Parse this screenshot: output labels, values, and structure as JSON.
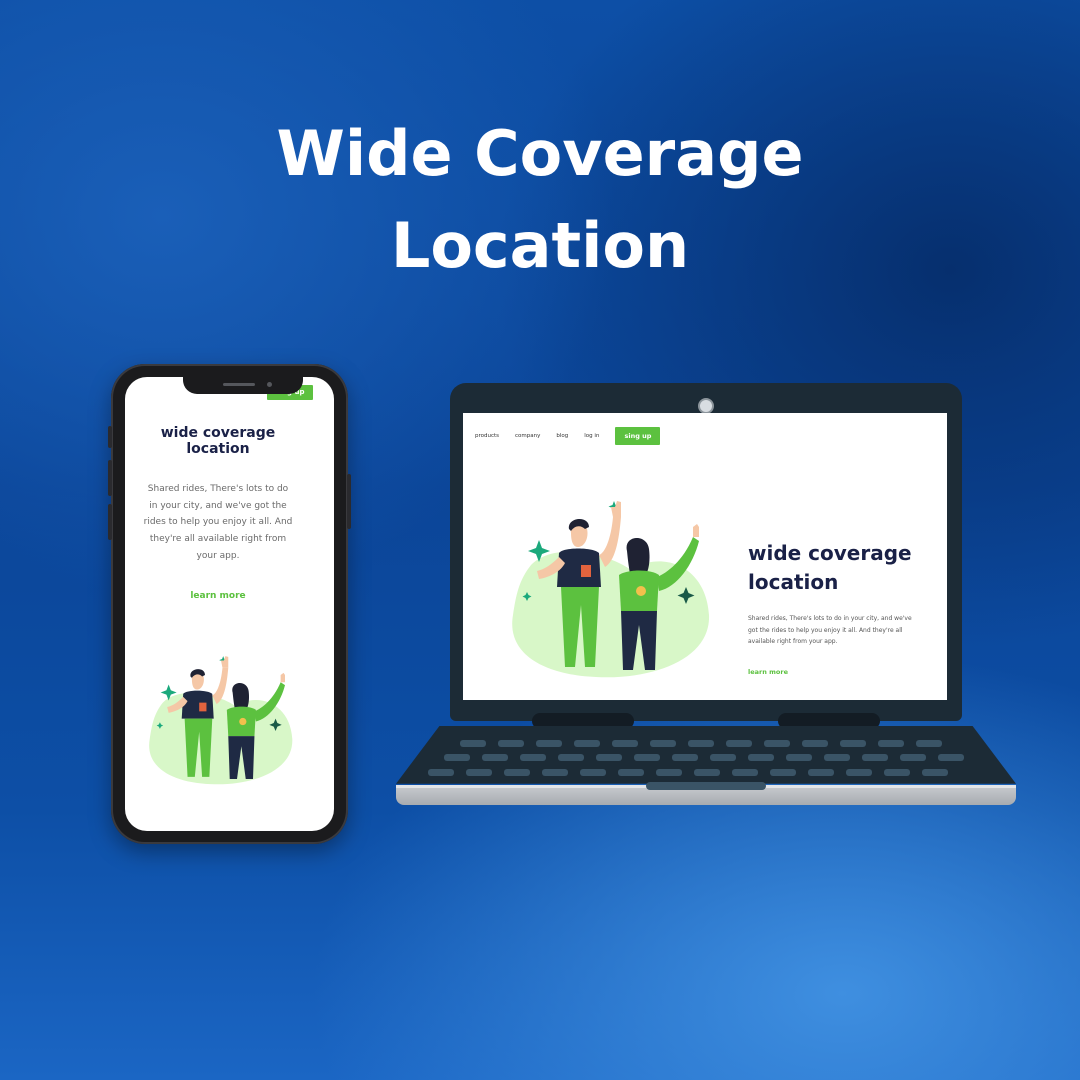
{
  "headline": {
    "line1": "Wide Coverage",
    "line2": "Location"
  },
  "mobile": {
    "signup_label": "sing up",
    "title_line1": "wide coverage",
    "title_line2": "location",
    "body": "Shared rides, There's lots to do in your city, and we've got the rides to help you enjoy it all. And they're all available right from your app.",
    "learn_more": "learn more"
  },
  "desktop": {
    "nav": [
      "products",
      "company",
      "blog",
      "log in"
    ],
    "signup_label": "sing up",
    "title_line1": "wide coverage",
    "title_line2": "location",
    "body": "Shared rides, There's lots to do in your city, and we've got the rides to help you enjoy it all. And they're all available right from your app.",
    "learn_more": "learn more"
  },
  "colors": {
    "brand_green": "#5cc13f",
    "title_navy": "#1a2147",
    "background_blue": "#0b4598"
  },
  "icons": [
    "phone-notch-speaker-icon",
    "webcam-icon",
    "sparkle-icon"
  ]
}
